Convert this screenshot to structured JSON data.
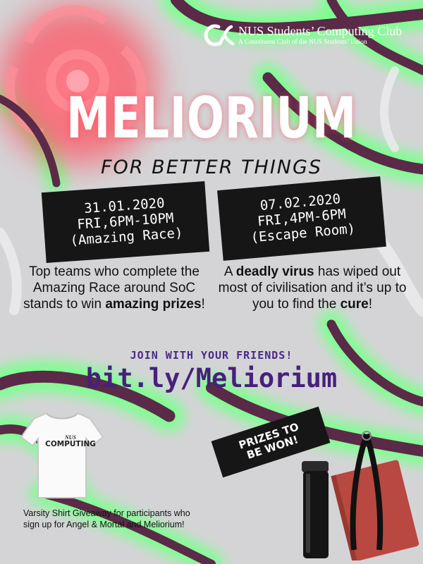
{
  "club": {
    "name": "NUS Students’ Computing Club",
    "subtitle": "A Constituent Club of the NUS Students’ Union"
  },
  "event": {
    "title": "MELIORIUM",
    "tagline": "FOR BETTER THINGS"
  },
  "sessions": [
    {
      "date": "31.01.2020",
      "time": "FRI,6PM-10PM",
      "name": "(Amazing Race)",
      "description_pre": "Top teams who complete the Amazing Race around SoC stands to win ",
      "description_bold": "amazing prizes",
      "description_post": "!"
    },
    {
      "date": "07.02.2020",
      "time": "FRI,4PM-6PM",
      "name": "(Escape Room)",
      "description_pre": "A ",
      "description_bold": "deadly virus",
      "description_mid": " has wiped out most of civilisation and it’s up to you to find the ",
      "description_bold2": "cure",
      "description_post": "!"
    }
  ],
  "signup": {
    "prompt": "JOIN WITH YOUR FRIENDS!",
    "link": "bit.ly/Meliorium"
  },
  "prizes": {
    "badge_line1": "PRIZES TO",
    "badge_line2": "BE WON!",
    "shirt_text_top": "NUS",
    "shirt_text_main": "COMPUTING",
    "caption": "Varsity Shirt Giveaway for participants who sign up for Angel & Mortal and Meliorium!"
  },
  "colors": {
    "background": "#d4d4d6",
    "glow_green": "#7dff8e",
    "glow_red": "#ff4a5a",
    "purple_text": "#46217a",
    "tentacle": "#5a2a48"
  }
}
